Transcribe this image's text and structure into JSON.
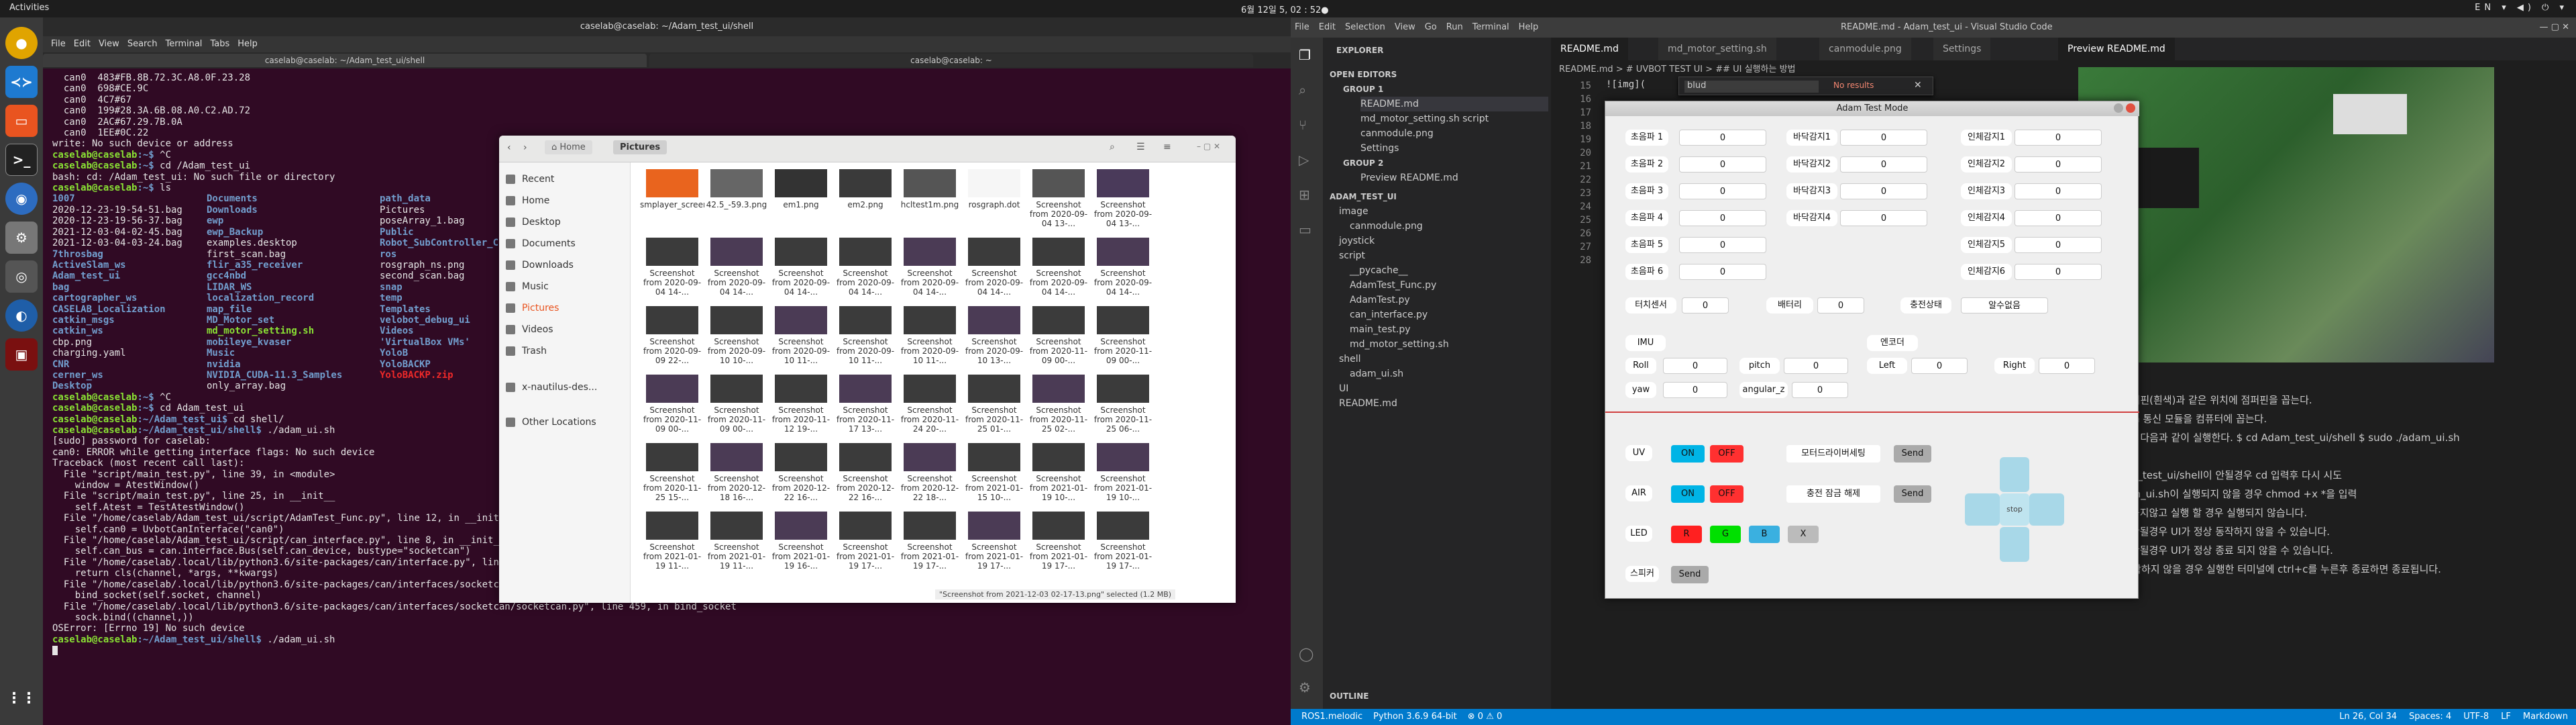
{
  "topbar": {
    "activities": "Activities",
    "clock": "6월 12일  5, 02 : 52●",
    "tray": "EN ▾ ◀) ⏻ ▾"
  },
  "terminal": {
    "title": "caselab@caselab: ~/Adam_test_ui/shell",
    "menu": [
      "File",
      "Edit",
      "View",
      "Search",
      "Terminal",
      "Tabs",
      "Help"
    ],
    "tabs": [
      "caselab@caselab: ~/Adam_test_ui/shell",
      "caselab@caselab: ~"
    ],
    "lines": [
      {
        "t": "  can0  483#FB.8B.72.3C.A8.0F.23.28"
      },
      {
        "t": "  can0  698#CE.9C"
      },
      {
        "t": "  can0  4C7#67"
      },
      {
        "t": "  can0  199#28.3A.6B.08.A0.C2.AD.72"
      },
      {
        "t": "  can0  2AC#67.29.7B.0A"
      },
      {
        "t": "  can0  1EE#0C.22"
      },
      {
        "t": "write: No such device or address"
      },
      {
        "p": "caselab@caselab",
        "d": ":~$ ",
        "c": "^C"
      },
      {
        "p": "caselab@caselab",
        "d": ":~$ ",
        "c": "cd /Adam_test_ui"
      },
      {
        "t": "bash: cd: /Adam_test_ui: No such file or directory"
      },
      {
        "p": "caselab@caselab",
        "d": ":~$ ",
        "c": "ls"
      },
      {
        "cols": [
          "1007",
          "Documents",
          "path_data"
        ]
      },
      {
        "cols": [
          "2020-12-23-19-54-51.bag",
          "Downloads",
          "Pictures"
        ],
        "w": [
          0,
          1,
          0
        ]
      },
      {
        "cols": [
          "2020-12-23-19-56-37.bag",
          "ewp",
          "poseArray_1.bag"
        ],
        "w": [
          0,
          1,
          0
        ]
      },
      {
        "cols": [
          "2021-12-03-04-02-45.bag",
          "ewp_Backup",
          "Public"
        ],
        "w": [
          0,
          1,
          1
        ]
      },
      {
        "cols": [
          "2021-12-03-04-03-24.bag",
          "examples.desktop",
          "Robot_SubController_C"
        ],
        "w": [
          0,
          0,
          1
        ]
      },
      {
        "cols": [
          "7throsbag",
          "first_scan.bag",
          "ros"
        ],
        "w": [
          1,
          0,
          1
        ]
      },
      {
        "cols": [
          "ActiveSlam_ws",
          "flir_a35_receiver",
          "rosgraph_ns.png"
        ],
        "w": [
          1,
          1,
          0
        ]
      },
      {
        "cols": [
          "Adam_test_ui",
          "gcc4nbd",
          "second_scan.bag"
        ],
        "w": [
          1,
          1,
          0
        ]
      },
      {
        "cols": [
          "bag",
          "LIDAR_WS",
          "snap"
        ],
        "w": [
          1,
          1,
          1
        ]
      },
      {
        "cols": [
          "cartographer_ws",
          "localization_record",
          "temp"
        ],
        "w": [
          1,
          1,
          1
        ]
      },
      {
        "cols": [
          "CASELAB_Localization",
          "map_file",
          "Templates"
        ],
        "w": [
          1,
          1,
          1
        ]
      },
      {
        "cols": [
          "catkin_msgs",
          "MD_Motor_set",
          "velobot_debug_ui"
        ],
        "w": [
          1,
          1,
          1
        ]
      },
      {
        "cols": [
          "catkin_ws",
          "md_motor_setting.sh",
          "Videos"
        ],
        "w": [
          1,
          2,
          1
        ]
      },
      {
        "cols": [
          "cbp.png",
          "mobileye_kvaser",
          "'VirtualBox VMs'"
        ],
        "w": [
          0,
          1,
          1
        ]
      },
      {
        "cols": [
          "charging.yaml",
          "Music",
          "YoloB"
        ],
        "w": [
          0,
          1,
          1
        ]
      },
      {
        "cols": [
          "CNR",
          "nvidia",
          "YoloBACKP"
        ],
        "w": [
          1,
          1,
          1
        ]
      },
      {
        "cols": [
          "cerner_ws",
          "NVIDIA_CUDA-11.3_Samples",
          "YoloBACKP.zip"
        ],
        "w": [
          1,
          1,
          3
        ]
      },
      {
        "cols": [
          "Desktop",
          "only_array.bag",
          ""
        ],
        "w": [
          1,
          0,
          0
        ]
      },
      {
        "p": "caselab@caselab",
        "d": ":~$ ",
        "c": "^C"
      },
      {
        "p": "caselab@caselab",
        "d": ":~$ ",
        "c": "cd Adam_test_ui"
      },
      {
        "p": "caselab@caselab",
        "d": ":~/Adam_test_ui$ ",
        "c": "cd shell/"
      },
      {
        "p": "caselab@caselab",
        "d": ":~/Adam_test_ui/shell$ ",
        "c": "./adam_ui.sh"
      },
      {
        "t": "[sudo] password for caselab:"
      },
      {
        "t": "can0: ERROR while getting interface flags: No such device"
      },
      {
        "t": "Traceback (most recent call last):"
      },
      {
        "t": "  File \"script/main_test.py\", line 39, in <module>"
      },
      {
        "t": "    window = AtestWindow()"
      },
      {
        "t": "  File \"script/main_test.py\", line 25, in __init__"
      },
      {
        "t": "    self.Atest = TestAtestWindow()"
      },
      {
        "t": "  File \"/home/caselab/Adam_test_ui/script/AdamTest_Func.py\", line 12, in __init__"
      },
      {
        "t": "    self.can0 = UvbotCanInterface(\"can0\")"
      },
      {
        "t": "  File \"/home/caselab/Adam_test_ui/script/can_interface.py\", line 8, in __init__"
      },
      {
        "t": "    self.can_bus = can.interface.Bus(self.can_device, bustype=\"socketcan\")"
      },
      {
        "t": "  File \"/home/caselab/.local/lib/python3.6/site-packages/can/interface.py\", line 127, in __new__"
      },
      {
        "t": "    return cls(channel, *args, **kwargs)"
      },
      {
        "t": "  File \"/home/caselab/.local/lib/python3.6/site-packages/can/interfaces/socketcan/socketcan.py\", line 594, in __init__"
      },
      {
        "t": "    bind_socket(self.socket, channel)"
      },
      {
        "t": "  File \"/home/caselab/.local/lib/python3.6/site-packages/can/interfaces/socketcan/socketcan.py\", line 459, in bind_socket"
      },
      {
        "t": "    sock.bind((channel,))"
      },
      {
        "t": "OSError: [Errno 19] No such device"
      },
      {
        "p": "caselab@caselab",
        "d": ":~/Adam_test_ui/shell$ ",
        "c": "./adam_ui.sh"
      }
    ]
  },
  "files": {
    "path": "Pictures",
    "home": "Home",
    "sidebar": [
      "Recent",
      "Home",
      "Desktop",
      "Documents",
      "Downloads",
      "Music",
      "Pictures",
      "Videos",
      "Trash",
      "x-nautilus-des...",
      "Other Locations"
    ],
    "items": [
      "smplayer_screenshots",
      "42.5_-59.3.png",
      "em1.png",
      "em2.png",
      "hcltest1m.png",
      "rosgraph.dot",
      "Screenshot from 2020-09-04 13-...",
      "Screenshot from 2020-09-04 13-...",
      "Screenshot from 2020-09-04 14-...",
      "Screenshot from 2020-09-04 14-...",
      "Screenshot from 2020-09-04 14-...",
      "Screenshot from 2020-09-04 14-...",
      "Screenshot from 2020-09-04 14-...",
      "Screenshot from 2020-09-04 14-...",
      "Screenshot from 2020-09-04 14-...",
      "Screenshot from 2020-09-04 14-...",
      "Screenshot from 2020-09-09 22-...",
      "Screenshot from 2020-09-10 10-...",
      "Screenshot from 2020-09-10 11-...",
      "Screenshot from 2020-09-10 11-...",
      "Screenshot from 2020-09-10 11-...",
      "Screenshot from 2020-09-10 13-...",
      "Screenshot from 2020-11-09 00-...",
      "Screenshot from 2020-11-09 00-...",
      "Screenshot from 2020-11-09 00-...",
      "Screenshot from 2020-11-09 00-...",
      "Screenshot from 2020-11-12 19-...",
      "Screenshot from 2020-11-17 13-...",
      "Screenshot from 2020-11-24 20-...",
      "Screenshot from 2020-11-25 01-...",
      "Screenshot from 2020-11-25 02-...",
      "Screenshot from 2020-11-25 06-...",
      "Screenshot from 2020-11-25 15-...",
      "Screenshot from 2020-12-18 16-...",
      "Screenshot from 2020-12-22 16-...",
      "Screenshot from 2020-12-22 16-...",
      "Screenshot from 2020-12-22 18-...",
      "Screenshot from 2021-01-15 10-...",
      "Screenshot from 2021-01-19 10-...",
      "Screenshot from 2021-01-19 10-...",
      "Screenshot from 2021-01-19 11-...",
      "Screenshot from 2021-01-19 11-...",
      "Screenshot from 2021-01-19 16-...",
      "Screenshot from 2021-01-19 17-...",
      "Screenshot from 2021-01-19 17-...",
      "Screenshot from 2021-01-19 17-...",
      "Screenshot from 2021-01-19 17-...",
      "Screenshot from 2021-01-19 17-..."
    ],
    "status": "\"Screenshot from 2021-12-03 02-17-13.png\" selected (1.2 MB)"
  },
  "vscode": {
    "title": "README.md - Adam_test_ui - Visual Studio Code",
    "menu": [
      "File",
      "Edit",
      "Selection",
      "View",
      "Go",
      "Run",
      "Terminal",
      "Help"
    ],
    "explorer": "EXPLORER",
    "open_editors": "OPEN EDITORS",
    "group1": "GROUP 1",
    "group2": "GROUP 2",
    "open_items": [
      "README.md",
      "md_motor_setting.sh  script",
      "canmodule.png",
      "Settings"
    ],
    "preview_item": "Preview README.md",
    "root": "ADAM_TEST_UI",
    "tree": [
      "image",
      "canmodule.png",
      "joystick",
      "script",
      "__pycache__",
      "AdamTest_Func.py",
      "AdamTest.py",
      "can_interface.py",
      "main_test.py",
      "md_motor_setting.sh",
      "shell",
      "adam_ui.sh",
      "UI",
      "README.md"
    ],
    "outline": "OUTLINE",
    "tabs": [
      "README.md",
      "md_motor_setting.sh",
      "canmodule.png",
      "Settings"
    ],
    "preview_tab": "Preview README.md",
    "breadcrumb": "README.md > # UVBOT TEST UI > ## UI 실행하는 방법",
    "find": "blud",
    "find_result": "No results",
    "line_numbers": [
      "15",
      "16",
      "17",
      "18",
      "19",
      "20",
      "21",
      "22",
      "23",
      "24",
      "25",
      "26",
      "27",
      "28"
    ],
    "code_first": "![img](",
    "preview_lines": [
      "위 사진의 점퍼핀(흰색)과 같은 위치에 점퍼핀을 꼽는다.",
      "위 사진의 can 통신 모듈을 컴퓨터에 꼽는다.",
      "터미널을 열어 다음과 같이 실행한다. $ cd Adam_test_ui/shell $ sudo ./adam_ui.sh",
      "",
      "cd cd Adam_test_ui/shell이 안될경우 cd 입력후 다시 시도",
      "sudo ./adam_ui.sh이 실행되지 않을 경우 chmod +x *을 입력",
      "can 모듈을 꼽지않고 실행 할 경우 실행되지 않습니다.",
      "can 통신이 안될경우 UI가 정상 동작하지 않을 수 있습니다.",
      "can 통신이 안될경우 UI가 정상 종료 되지 않을 수 있습니다.",
      "UI가 정상 동작하지 않을 경우 실행한 터미널에 ctrl+c를 누른후 종료하면 종료됩니다."
    ],
    "status_left": [
      "ROS1.melodic",
      "Python 3.6.9 64-bit",
      "⊗ 0 ⚠ 0"
    ],
    "status_right": [
      "Ln 26, Col 34",
      "Spaces: 4",
      "UTF-8",
      "LF",
      "Markdown"
    ]
  },
  "atm": {
    "title": "Adam Test Mode",
    "ultra": [
      "초음파 1",
      "초음파 2",
      "초음파 3",
      "초음파 4",
      "초음파 5",
      "초음파 6"
    ],
    "ultra_vals": [
      "0",
      "0",
      "0",
      "0",
      "0",
      "0"
    ],
    "floor": [
      "바닥감지1",
      "바닥감지2",
      "바닥감지3",
      "바닥감지4"
    ],
    "floor_vals": [
      "0",
      "0",
      "0",
      "0"
    ],
    "human": [
      "인체감지1",
      "인체감지2",
      "인체감지3",
      "인체감지4",
      "인체감지5",
      "인체감지6"
    ],
    "human_vals": [
      "0",
      "0",
      "0",
      "0",
      "0",
      "0"
    ],
    "touch": "터치센서",
    "touch_val": "0",
    "battery": "배터리",
    "battery_val": "0",
    "charge": "충전상태",
    "charge_val": "알수없음",
    "encoder": "엔코더",
    "imu": "IMU",
    "roll": "Roll",
    "roll_val": "0",
    "pitch": "pitch",
    "pitch_val": "0",
    "yaw": "yaw",
    "yaw_val": "0",
    "angular": "angular_z",
    "angular_val": "0",
    "left": "Left",
    "left_val": "0",
    "right": "Right",
    "right_val": "0",
    "uv": "UV",
    "air": "AIR",
    "on": "ON",
    "off": "OFF",
    "motor_driver": "모터드라이버세팅",
    "charge_release": "충전 잠금 해제",
    "send": "Send",
    "led": "LED",
    "r": "R",
    "g": "G",
    "b": "B",
    "x": "X",
    "speaker": "스피커",
    "stop": "stop",
    "colors": {
      "on": "#00b4e6",
      "off": "#ff3030",
      "r": "#ff2020",
      "g": "#00e000",
      "b": "#3ab0e0"
    }
  }
}
